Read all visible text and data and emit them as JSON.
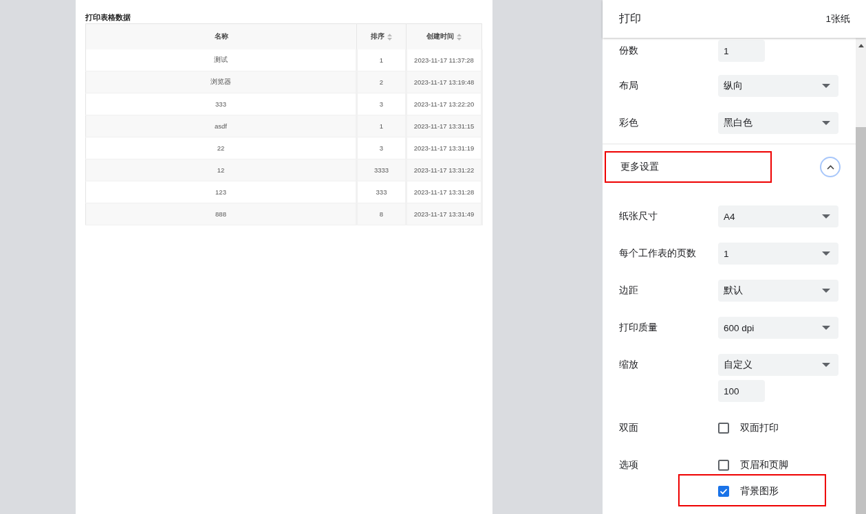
{
  "preview": {
    "title": "打印表格数据",
    "columns": [
      {
        "label": "名称",
        "sortable": false
      },
      {
        "label": "排序",
        "sortable": true
      },
      {
        "label": "创建时间",
        "sortable": true
      }
    ],
    "rows": [
      [
        "测试",
        "1",
        "2023-11-17 11:37:28"
      ],
      [
        "浏览器",
        "2",
        "2023-11-17 13:19:48"
      ],
      [
        "333",
        "3",
        "2023-11-17 13:22:20"
      ],
      [
        "asdf",
        "1",
        "2023-11-17 13:31:15"
      ],
      [
        "22",
        "3",
        "2023-11-17 13:31:19"
      ],
      [
        "12",
        "3333",
        "2023-11-17 13:31:22"
      ],
      [
        "123",
        "333",
        "2023-11-17 13:31:28"
      ],
      [
        "888",
        "8",
        "2023-11-17 13:31:49"
      ]
    ]
  },
  "panel": {
    "title": "打印",
    "sheet_count": "1张纸",
    "settings": [
      {
        "kind": "number",
        "label": "份数",
        "value": "1"
      },
      {
        "kind": "select",
        "label": "布局",
        "value": "纵向"
      },
      {
        "kind": "select",
        "label": "彩色",
        "value": "黑白色"
      },
      {
        "kind": "section",
        "label": "更多设置",
        "expanded": true,
        "highlighted": true
      },
      {
        "kind": "select",
        "label": "纸张尺寸",
        "value": "A4"
      },
      {
        "kind": "select",
        "label": "每个工作表的页数",
        "value": "1"
      },
      {
        "kind": "select",
        "label": "边距",
        "value": "默认"
      },
      {
        "kind": "select",
        "label": "打印质量",
        "value": "600 dpi"
      },
      {
        "kind": "select",
        "label": "缩放",
        "value": "自定义",
        "custom_value": "100"
      },
      {
        "kind": "checkboxes",
        "label": "双面",
        "options": [
          {
            "label": "双面打印",
            "checked": false,
            "highlighted": false
          }
        ]
      },
      {
        "kind": "checkboxes",
        "label": "选项",
        "options": [
          {
            "label": "页眉和页脚",
            "checked": false,
            "highlighted": false
          },
          {
            "label": "背景图形",
            "checked": true,
            "highlighted": true
          }
        ]
      }
    ]
  }
}
